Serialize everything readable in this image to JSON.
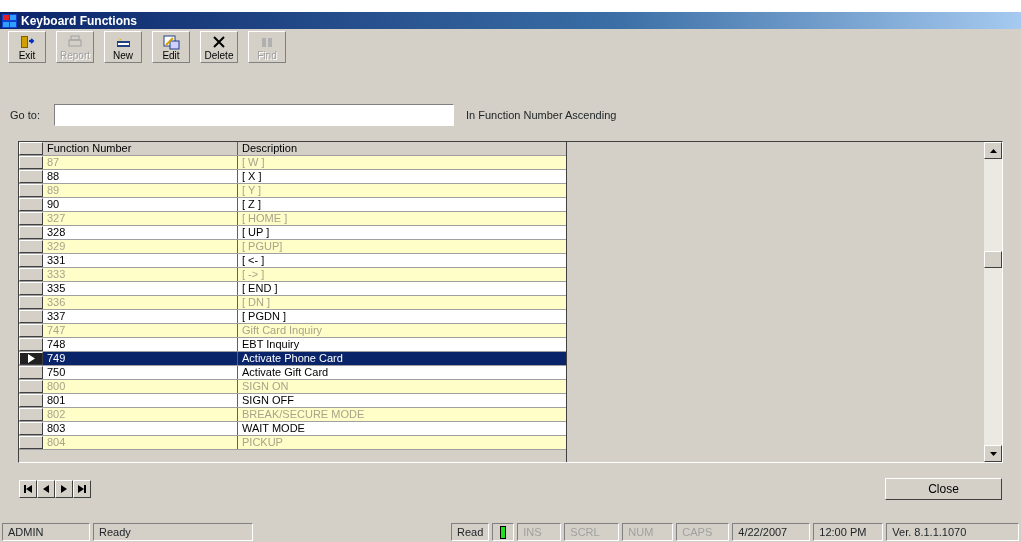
{
  "window": {
    "title": "Keyboard Functions"
  },
  "toolbar": [
    {
      "label": "Exit",
      "kind": "exit",
      "disabled": false
    },
    {
      "label": "Report",
      "kind": "report",
      "disabled": true
    },
    {
      "label": "New",
      "kind": "new",
      "disabled": false
    },
    {
      "label": "Edit",
      "kind": "edit",
      "disabled": false
    },
    {
      "label": "Delete",
      "kind": "delete",
      "disabled": false
    },
    {
      "label": "Find",
      "kind": "find",
      "disabled": true
    }
  ],
  "goto": {
    "label": "Go to:",
    "sort_note": "In Function Number Ascending"
  },
  "table": {
    "columns": [
      "Function Number",
      "Description"
    ],
    "rows": [
      {
        "number": "87",
        "description": "[ W ]",
        "dimmed": true,
        "selected": false
      },
      {
        "number": "88",
        "description": "[ X ]",
        "dimmed": false,
        "selected": false
      },
      {
        "number": "89",
        "description": "[ Y ]",
        "dimmed": true,
        "selected": false
      },
      {
        "number": "90",
        "description": "[ Z ]",
        "dimmed": false,
        "selected": false
      },
      {
        "number": "327",
        "description": "[ HOME ]",
        "dimmed": true,
        "selected": false
      },
      {
        "number": "328",
        "description": "[ UP ]",
        "dimmed": false,
        "selected": false
      },
      {
        "number": "329",
        "description": "[ PGUP]",
        "dimmed": true,
        "selected": false
      },
      {
        "number": "331",
        "description": "[ <- ]",
        "dimmed": false,
        "selected": false
      },
      {
        "number": "333",
        "description": "[ -> ]",
        "dimmed": true,
        "selected": false
      },
      {
        "number": "335",
        "description": "[ END ]",
        "dimmed": false,
        "selected": false
      },
      {
        "number": "336",
        "description": "[ DN ]",
        "dimmed": true,
        "selected": false
      },
      {
        "number": "337",
        "description": "[ PGDN ]",
        "dimmed": false,
        "selected": false
      },
      {
        "number": "747",
        "description": "Gift Card Inquiry",
        "dimmed": true,
        "selected": false
      },
      {
        "number": "748",
        "description": "EBT Inquiry",
        "dimmed": false,
        "selected": false
      },
      {
        "number": "749",
        "description": "Activate Phone Card",
        "dimmed": false,
        "selected": true
      },
      {
        "number": "750",
        "description": "Activate Gift Card",
        "dimmed": false,
        "selected": false
      },
      {
        "number": "800",
        "description": "SIGN ON",
        "dimmed": true,
        "selected": false
      },
      {
        "number": "801",
        "description": "SIGN OFF",
        "dimmed": false,
        "selected": false
      },
      {
        "number": "802",
        "description": "BREAK/SECURE MODE",
        "dimmed": true,
        "selected": false
      },
      {
        "number": "803",
        "description": "WAIT MODE",
        "dimmed": false,
        "selected": false
      },
      {
        "number": "804",
        "description": "PICKUP",
        "dimmed": true,
        "selected": false
      }
    ]
  },
  "close_button": "Close",
  "status_bar": [
    {
      "text": "ADMIN",
      "kind": "text",
      "disabled": false
    },
    {
      "text": "Ready",
      "kind": "text",
      "disabled": false
    },
    {
      "text": "Read",
      "kind": "text",
      "disabled": false
    },
    {
      "kind": "light",
      "on": true
    },
    {
      "text": "INS",
      "kind": "text",
      "disabled": true
    },
    {
      "text": "SCRL",
      "kind": "text",
      "disabled": true
    },
    {
      "text": "NUM",
      "kind": "text",
      "disabled": true
    },
    {
      "text": "CAPS",
      "kind": "text",
      "disabled": true
    },
    {
      "text": "4/22/2007",
      "kind": "text",
      "disabled": false
    },
    {
      "text": "12:00 PM",
      "kind": "text",
      "disabled": false
    },
    {
      "text": "Ver. 8.1.1.1070",
      "kind": "text",
      "disabled": false
    }
  ]
}
